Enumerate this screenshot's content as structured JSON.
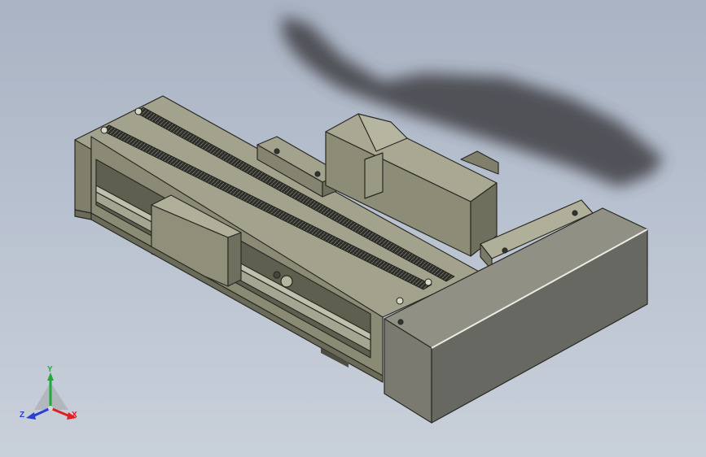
{
  "viewport": {
    "background_top": "#a9b3c3",
    "background_bottom": "#c9d0da"
  },
  "model": {
    "body_color": "#93937e",
    "body_dark": "#6b6b5a",
    "cover_face": "#686862",
    "cover_top": "#909085",
    "belt_color": "#2c2c28",
    "shadow_color": "#3f4045"
  },
  "triad": {
    "x_label": "X",
    "y_label": "Y",
    "z_label": "Z",
    "x_color": "#e02020",
    "y_color": "#1faa3a",
    "z_color": "#2a3fd0"
  }
}
